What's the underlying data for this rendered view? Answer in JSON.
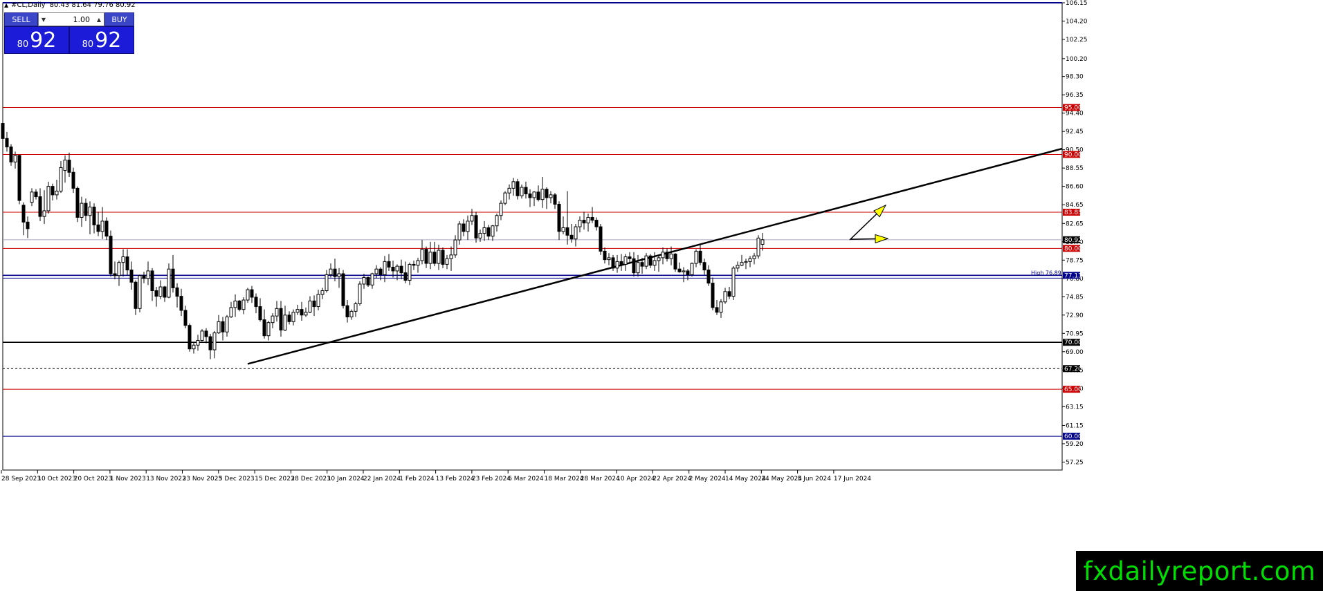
{
  "header": {
    "symbol": "#CL,Daily",
    "ohlc": "80.43 81.64 79.76 80.92"
  },
  "trade_panel": {
    "sell_label": "SELL",
    "buy_label": "BUY",
    "lot_value": "1.00",
    "sell_price_small": "80",
    "sell_price_big": "92",
    "buy_price_small": "80",
    "buy_price_big": "92"
  },
  "watermark": "fxdailyreport.com",
  "colors": {
    "candle_up": "#ffffff",
    "candle_down": "#000000",
    "level_red": "#cc0000",
    "level_blue": "#00008b",
    "trendline": "#000000",
    "arrow": "#ffff00",
    "watermark_text": "#00dd00"
  },
  "chart_data": {
    "type": "candlestick",
    "symbol": "#CL",
    "timeframe": "Daily",
    "ylim": [
      56.4,
      106.15
    ],
    "y_ticks": [
      "106.15",
      "104.20",
      "102.25",
      "100.20",
      "98.30",
      "96.35",
      "94.40",
      "92.45",
      "90.50",
      "88.55",
      "86.60",
      "84.65",
      "82.65",
      "80.70",
      "78.75",
      "76.80",
      "74.85",
      "72.90",
      "70.95",
      "69.00",
      "67.05",
      "65.10",
      "63.15",
      "61.15",
      "59.20",
      "57.25"
    ],
    "x_labels": [
      "28 Sep 2023",
      "10 Oct 2023",
      "20 Oct 2023",
      "1 Nov 2023",
      "13 Nov 2023",
      "23 Nov 2023",
      "5 Dec 2023",
      "15 Dec 2023",
      "28 Dec 2023",
      "10 Jan 2024",
      "22 Jan 2024",
      "1 Feb 2024",
      "13 Feb 2024",
      "23 Feb 2024",
      "6 Mar 2024",
      "18 Mar 2024",
      "28 Mar 2024",
      "10 Apr 2024",
      "22 Apr 2024",
      "2 May 2024",
      "14 May 2024",
      "24 May 2024",
      "5 Jun 2024",
      "17 Jun 2024"
    ],
    "horizontal_levels": [
      {
        "price": 95.0,
        "label": "95.00",
        "color": "#cc0000"
      },
      {
        "price": 90.0,
        "label": "90.00",
        "color": "#cc0000"
      },
      {
        "price": 83.85,
        "label": "83.85",
        "color": "#cc0000"
      },
      {
        "price": 80.0,
        "label": "80.00",
        "color": "#cc0000"
      },
      {
        "price": 77.13,
        "label": "77.13",
        "color": "#00008b"
      },
      {
        "price": 70.0,
        "label": "70.00",
        "color": "#000000"
      },
      {
        "price": 67.2,
        "label": "67.20",
        "color": "#000000",
        "dashed": true
      },
      {
        "price": 65.0,
        "label": "65.00",
        "color": "#cc0000"
      },
      {
        "price": 60.0,
        "label": "60.00",
        "color": "#00008b"
      }
    ],
    "current_price": {
      "price": 80.92,
      "label": "80.92"
    },
    "high_label": "High",
    "high_value": "76.89",
    "trendline": {
      "start": {
        "date": "12 Dec 2023",
        "price": 67.7
      },
      "through": {
        "date": "2 May 2024",
        "price": 80.2
      }
    },
    "candles": [
      [
        93.3,
        95.0,
        90.8,
        91.7
      ],
      [
        91.7,
        92.4,
        90.3,
        90.8
      ],
      [
        90.8,
        91.1,
        88.8,
        89.2
      ],
      [
        89.2,
        90.3,
        88.5,
        89.9
      ],
      [
        89.9,
        90.0,
        84.7,
        85.1
      ],
      [
        84.6,
        84.9,
        81.4,
        82.8
      ],
      [
        82.8,
        83.4,
        81.1,
        82.1
      ],
      [
        84.9,
        86.4,
        84.5,
        86.0
      ],
      [
        86.0,
        86.3,
        85.2,
        85.5
      ],
      [
        85.5,
        86.4,
        82.9,
        83.4
      ],
      [
        83.4,
        86.2,
        82.6,
        84.0
      ],
      [
        84.0,
        87.1,
        83.7,
        86.6
      ],
      [
        86.6,
        86.9,
        85.1,
        85.7
      ],
      [
        85.7,
        87.3,
        85.2,
        86.1
      ],
      [
        86.1,
        89.3,
        85.9,
        88.6
      ],
      [
        88.3,
        89.9,
        87.0,
        89.4
      ],
      [
        89.4,
        90.2,
        87.6,
        88.1
      ],
      [
        88.1,
        88.6,
        85.9,
        86.4
      ],
      [
        86.4,
        86.6,
        82.8,
        83.3
      ],
      [
        83.3,
        85.5,
        82.3,
        84.8
      ],
      [
        84.8,
        85.3,
        82.9,
        83.5
      ],
      [
        83.5,
        85.0,
        81.5,
        84.4
      ],
      [
        84.4,
        84.8,
        81.6,
        82.5
      ],
      [
        82.5,
        83.9,
        81.3,
        81.8
      ],
      [
        81.8,
        84.4,
        81.0,
        82.9
      ],
      [
        82.9,
        83.3,
        80.9,
        81.3
      ],
      [
        81.3,
        81.9,
        77.0,
        77.3
      ],
      [
        77.3,
        78.6,
        76.7,
        77.1
      ],
      [
        77.1,
        78.7,
        76.0,
        78.5
      ],
      [
        78.5,
        79.9,
        77.0,
        79.1
      ],
      [
        79.1,
        79.9,
        77.1,
        77.7
      ],
      [
        77.7,
        78.6,
        75.6,
        76.4
      ],
      [
        76.4,
        76.6,
        72.9,
        73.6
      ],
      [
        73.6,
        77.2,
        73.2,
        77.1
      ],
      [
        77.1,
        77.5,
        76.3,
        76.8
      ],
      [
        76.8,
        78.6,
        76.1,
        77.6
      ],
      [
        77.6,
        77.9,
        74.4,
        75.5
      ],
      [
        75.5,
        75.9,
        73.8,
        74.9
      ],
      [
        74.9,
        76.6,
        74.6,
        75.9
      ],
      [
        75.9,
        76.0,
        74.3,
        74.8
      ],
      [
        74.8,
        78.4,
        74.7,
        77.8
      ],
      [
        77.8,
        79.3,
        75.3,
        75.8
      ],
      [
        75.8,
        76.3,
        73.7,
        74.9
      ],
      [
        74.9,
        75.7,
        72.8,
        73.4
      ],
      [
        73.4,
        73.9,
        71.5,
        71.8
      ],
      [
        71.8,
        72.0,
        69.0,
        69.3
      ],
      [
        69.3,
        70.0,
        68.8,
        69.7
      ],
      [
        69.7,
        70.8,
        69.1,
        70.2
      ],
      [
        70.2,
        71.4,
        70.1,
        71.2
      ],
      [
        71.2,
        71.5,
        69.9,
        70.6
      ],
      [
        70.6,
        70.9,
        68.2,
        69.2
      ],
      [
        69.2,
        71.2,
        68.3,
        71.0
      ],
      [
        71.0,
        72.9,
        70.9,
        72.2
      ],
      [
        72.2,
        72.7,
        70.2,
        71.1
      ],
      [
        71.1,
        72.9,
        70.6,
        72.7
      ],
      [
        72.7,
        74.3,
        72.6,
        73.7
      ],
      [
        73.7,
        75.1,
        72.7,
        74.4
      ],
      [
        74.4,
        74.5,
        73.3,
        73.5
      ],
      [
        73.5,
        74.8,
        73.0,
        74.5
      ],
      [
        74.5,
        75.8,
        74.2,
        75.6
      ],
      [
        75.6,
        76.0,
        74.2,
        74.8
      ],
      [
        74.8,
        75.2,
        73.1,
        73.8
      ],
      [
        73.8,
        74.7,
        72.2,
        72.4
      ],
      [
        72.4,
        73.5,
        70.4,
        70.7
      ],
      [
        70.7,
        72.3,
        70.2,
        72.1
      ],
      [
        72.1,
        73.1,
        71.5,
        72.8
      ],
      [
        72.8,
        74.4,
        72.2,
        73.6
      ],
      [
        73.6,
        74.4,
        70.6,
        71.3
      ],
      [
        71.3,
        73.9,
        71.2,
        72.9
      ],
      [
        72.9,
        73.3,
        71.9,
        72.2
      ],
      [
        72.2,
        73.5,
        71.8,
        73.2
      ],
      [
        73.2,
        74.0,
        72.9,
        73.5
      ],
      [
        73.5,
        74.3,
        72.3,
        72.9
      ],
      [
        72.9,
        73.7,
        72.7,
        73.2
      ],
      [
        73.2,
        74.9,
        73.1,
        74.4
      ],
      [
        74.4,
        75.0,
        72.8,
        73.8
      ],
      [
        73.8,
        75.6,
        73.4,
        75.1
      ],
      [
        75.1,
        75.8,
        74.6,
        75.5
      ],
      [
        75.5,
        77.7,
        75.3,
        77.2
      ],
      [
        77.2,
        78.4,
        76.9,
        77.8
      ],
      [
        77.8,
        78.9,
        76.5,
        77.0
      ],
      [
        77.0,
        77.9,
        75.8,
        77.3
      ],
      [
        77.3,
        77.7,
        73.6,
        73.9
      ],
      [
        73.9,
        74.5,
        72.1,
        72.7
      ],
      [
        72.7,
        73.5,
        72.4,
        73.3
      ],
      [
        73.3,
        74.3,
        72.7,
        74.1
      ],
      [
        74.1,
        76.5,
        73.9,
        76.2
      ],
      [
        76.2,
        77.3,
        75.7,
        76.9
      ],
      [
        76.9,
        77.0,
        75.9,
        76.1
      ],
      [
        76.1,
        77.4,
        75.7,
        77.3
      ],
      [
        77.3,
        78.2,
        76.8,
        77.8
      ],
      [
        77.8,
        78.0,
        76.6,
        77.2
      ],
      [
        77.2,
        79.2,
        76.4,
        78.6
      ],
      [
        78.6,
        79.4,
        77.6,
        78.0
      ],
      [
        78.0,
        78.7,
        76.9,
        77.6
      ],
      [
        77.6,
        78.3,
        76.6,
        78.1
      ],
      [
        78.1,
        78.8,
        76.7,
        77.4
      ],
      [
        77.4,
        78.6,
        76.3,
        76.6
      ],
      [
        76.6,
        78.5,
        76.1,
        78.3
      ],
      [
        78.3,
        78.7,
        77.7,
        78.2
      ],
      [
        78.2,
        79.0,
        77.4,
        78.7
      ],
      [
        78.7,
        80.9,
        78.3,
        79.9
      ],
      [
        79.9,
        80.2,
        77.9,
        78.4
      ],
      [
        78.4,
        80.7,
        77.8,
        79.6
      ],
      [
        79.6,
        80.7,
        78.1,
        78.4
      ],
      [
        78.4,
        80.4,
        77.7,
        79.8
      ],
      [
        79.8,
        80.1,
        77.9,
        78.3
      ],
      [
        78.3,
        79.3,
        77.8,
        78.9
      ],
      [
        78.9,
        80.2,
        77.6,
        79.3
      ],
      [
        79.3,
        81.4,
        79.0,
        80.9
      ],
      [
        80.9,
        82.9,
        80.4,
        82.6
      ],
      [
        82.6,
        83.1,
        81.3,
        81.8
      ],
      [
        81.8,
        83.5,
        80.9,
        82.9
      ],
      [
        82.9,
        84.2,
        82.5,
        83.5
      ],
      [
        83.5,
        83.9,
        80.6,
        81.1
      ],
      [
        81.1,
        82.0,
        80.7,
        81.6
      ],
      [
        81.6,
        82.9,
        80.8,
        82.2
      ],
      [
        82.2,
        82.5,
        80.9,
        81.3
      ],
      [
        81.3,
        82.5,
        80.8,
        82.4
      ],
      [
        82.4,
        83.7,
        81.8,
        83.5
      ],
      [
        83.5,
        85.1,
        83.0,
        84.8
      ],
      [
        84.8,
        86.1,
        84.6,
        85.9
      ],
      [
        85.9,
        86.8,
        85.2,
        86.4
      ],
      [
        86.4,
        87.5,
        85.6,
        87.1
      ],
      [
        87.1,
        87.4,
        85.2,
        85.6
      ],
      [
        85.6,
        86.8,
        85.3,
        86.5
      ],
      [
        86.5,
        87.1,
        85.3,
        85.8
      ],
      [
        85.8,
        86.3,
        84.4,
        85.4
      ],
      [
        85.4,
        86.1,
        84.5,
        86.0
      ],
      [
        86.0,
        86.7,
        85.0,
        85.2
      ],
      [
        85.2,
        87.6,
        84.3,
        86.3
      ],
      [
        86.3,
        86.5,
        84.2,
        85.4
      ],
      [
        85.4,
        86.1,
        84.8,
        85.7
      ],
      [
        85.7,
        85.9,
        84.2,
        84.7
      ],
      [
        84.7,
        85.0,
        80.9,
        81.8
      ],
      [
        81.8,
        83.4,
        81.5,
        82.2
      ],
      [
        82.2,
        86.1,
        80.4,
        81.4
      ],
      [
        81.4,
        82.6,
        80.6,
        81.0
      ],
      [
        81.0,
        82.6,
        80.2,
        82.3
      ],
      [
        82.3,
        83.4,
        81.7,
        83.0
      ],
      [
        83.0,
        83.9,
        82.0,
        82.7
      ],
      [
        82.7,
        83.7,
        81.8,
        83.3
      ],
      [
        83.3,
        84.4,
        82.7,
        83.0
      ],
      [
        83.0,
        83.3,
        81.9,
        82.3
      ],
      [
        82.3,
        82.6,
        79.3,
        79.7
      ],
      [
        79.7,
        80.1,
        78.4,
        78.8
      ],
      [
        78.8,
        79.5,
        78.2,
        79.0
      ],
      [
        79.0,
        79.3,
        77.6,
        77.9
      ],
      [
        77.9,
        79.3,
        77.4,
        78.6
      ],
      [
        78.6,
        79.4,
        77.6,
        78.3
      ],
      [
        78.3,
        79.4,
        77.6,
        79.1
      ],
      [
        79.1,
        79.6,
        78.4,
        78.9
      ],
      [
        78.9,
        79.6,
        77.0,
        77.4
      ],
      [
        77.4,
        79.3,
        77.0,
        78.5
      ],
      [
        78.5,
        79.0,
        77.3,
        78.1
      ],
      [
        78.1,
        79.5,
        77.8,
        79.2
      ],
      [
        79.2,
        79.4,
        77.9,
        78.2
      ],
      [
        78.2,
        79.6,
        77.6,
        78.7
      ],
      [
        78.7,
        79.2,
        77.5,
        79.0
      ],
      [
        79.0,
        80.1,
        78.3,
        79.6
      ],
      [
        79.6,
        80.0,
        78.6,
        78.9
      ],
      [
        78.9,
        80.2,
        78.2,
        79.4
      ],
      [
        79.4,
        79.5,
        77.5,
        77.8
      ],
      [
        77.8,
        78.5,
        77.4,
        77.5
      ],
      [
        77.5,
        78.0,
        76.4,
        77.6
      ],
      [
        77.6,
        77.8,
        76.6,
        77.2
      ],
      [
        77.2,
        78.5,
        77.0,
        78.4
      ],
      [
        78.4,
        79.9,
        78.0,
        79.7
      ],
      [
        79.7,
        80.4,
        78.2,
        78.5
      ],
      [
        78.5,
        78.9,
        77.2,
        77.7
      ],
      [
        77.7,
        78.2,
        76.0,
        76.3
      ],
      [
        76.3,
        76.9,
        73.4,
        73.7
      ],
      [
        73.7,
        74.5,
        72.9,
        73.2
      ],
      [
        73.2,
        74.6,
        72.6,
        74.3
      ],
      [
        74.3,
        75.8,
        74.1,
        75.4
      ],
      [
        75.4,
        75.9,
        74.6,
        74.9
      ],
      [
        74.9,
        78.1,
        74.5,
        77.9
      ],
      [
        77.9,
        78.6,
        77.5,
        78.2
      ],
      [
        78.2,
        79.3,
        78.1,
        78.5
      ],
      [
        78.5,
        78.9,
        77.8,
        78.6
      ],
      [
        78.6,
        79.2,
        78.0,
        78.9
      ],
      [
        78.9,
        79.5,
        78.3,
        79.2
      ],
      [
        79.2,
        81.4,
        78.9,
        81.1
      ],
      [
        80.43,
        81.64,
        79.76,
        80.92
      ]
    ]
  }
}
